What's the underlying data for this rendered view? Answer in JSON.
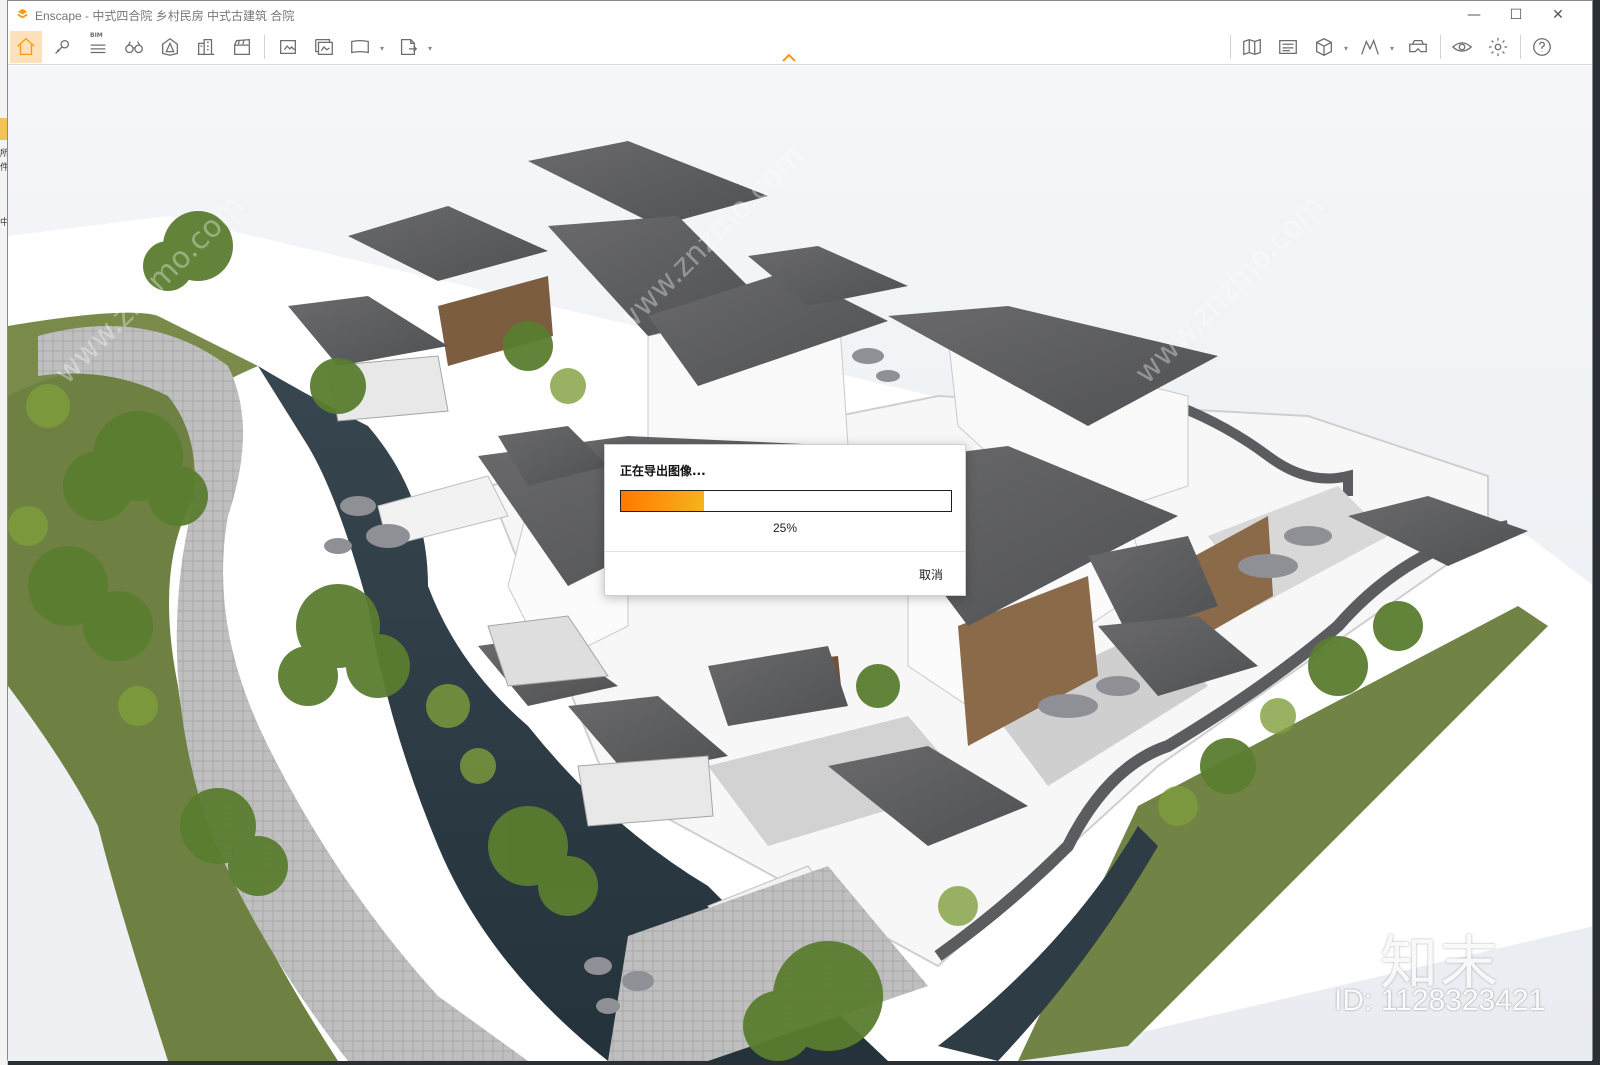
{
  "window": {
    "title": "Enscape - 中式四合院 乡村民房 中式古建筑 合院",
    "minimize_glyph": "—",
    "maximize_glyph": "☐",
    "close_glyph": "✕"
  },
  "left_strip": {
    "chars": [
      "所",
      "件",
      "中"
    ]
  },
  "toolbar": {
    "left_items": [
      {
        "name": "home-icon",
        "active": true
      },
      {
        "name": "link-icon"
      },
      {
        "name": "bim-icon",
        "label": "BIM"
      },
      {
        "name": "binoculars-icon"
      },
      {
        "name": "atmosphere-icon"
      },
      {
        "name": "buildings-icon"
      },
      {
        "name": "clapper-icon"
      },
      {
        "name": "screenshot-icon"
      },
      {
        "name": "batch-render-icon"
      },
      {
        "name": "panorama-icon"
      },
      {
        "name": "export-exe-icon"
      }
    ],
    "right_items": [
      {
        "name": "map-icon"
      },
      {
        "name": "asset-library-icon"
      },
      {
        "name": "cube-view-icon"
      },
      {
        "name": "walk-mode-icon"
      },
      {
        "name": "vr-headset-icon"
      },
      {
        "name": "visual-settings-icon"
      },
      {
        "name": "settings-gear-icon"
      },
      {
        "name": "help-icon"
      }
    ],
    "collapse_icon": "chevron-up-icon"
  },
  "dialog": {
    "title": "正在导出图像...",
    "progress": 0.25,
    "progress_text": "25%",
    "cancel_label": "取消"
  },
  "watermarks": {
    "brand": "知末",
    "id": "ID: 1128323421",
    "site": "www.znzmo.com"
  },
  "colors": {
    "accent": "#f59a14",
    "progress_start": "#ff7a00",
    "progress_end": "#f7b21d"
  }
}
